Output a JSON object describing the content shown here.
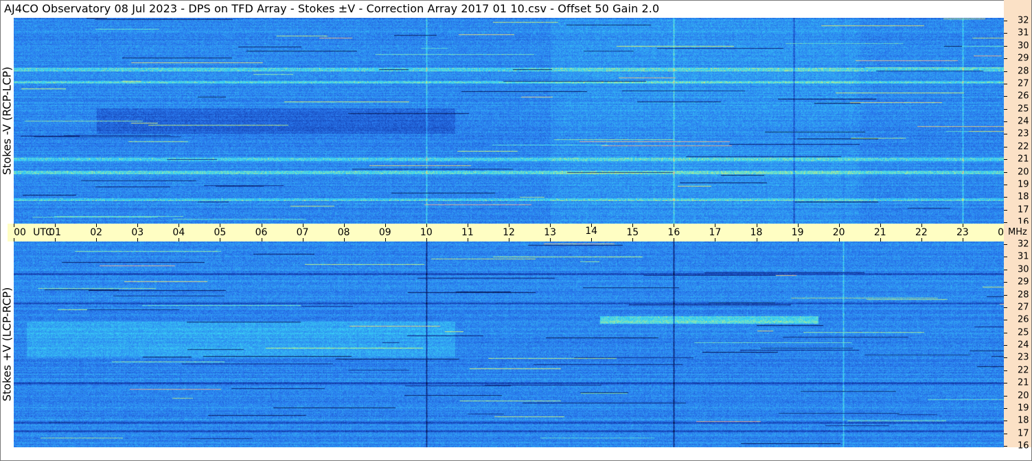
{
  "title": "AJ4CO Observatory  08 Jul 2023  -  DPS on TFD Array  -  Stokes ±V  -  Correction Array 2017 01 10.csv  -  Offset 50  Gain 2.0",
  "colors": {
    "background_blue": "#2a7bf0",
    "dark_blue": "#1646b8",
    "light_cyan": "#3ad6f5",
    "yellow_green": "#d8f070",
    "magenta": "#e060d0",
    "navy": "#061a55",
    "axis_yellow": "#fffec3",
    "axis_peach": "#fbe1c6"
  },
  "chart_data": [
    {
      "type": "heatmap",
      "name": "panel-top",
      "ylabel": "Stokes -V (RCP-LCP)",
      "x_unit": "UTC",
      "y_unit": "MHz",
      "xlim": [
        0,
        24
      ],
      "ylim": [
        16,
        32
      ],
      "x_ticks": [
        "00",
        "01",
        "02",
        "03",
        "04",
        "05",
        "06",
        "07",
        "08",
        "09",
        "10",
        "11",
        "12",
        "13",
        "14",
        "15",
        "16",
        "17",
        "18",
        "19",
        "20",
        "21",
        "22",
        "23",
        "00"
      ],
      "y_ticks": [
        "16",
        "17",
        "18",
        "19",
        "20",
        "21",
        "22",
        "23",
        "24",
        "25",
        "26",
        "27",
        "28",
        "29",
        "30",
        "31",
        "32"
      ],
      "features": {
        "bright_vertical_lines_hours": [
          10.0,
          16.0,
          20.1,
          23.0
        ],
        "dark_vertical_lines_hours": [
          18.9,
          20.1
        ],
        "dark_band_hours": [
          2.0,
          10.7
        ],
        "dark_band_mhz": [
          23.0,
          25.0
        ],
        "yellow_rows_mhz": [
          17.9,
          20.0,
          21.0,
          27.0,
          28.0
        ],
        "bright_region_hours": [
          13.0,
          20.5
        ]
      }
    },
    {
      "type": "heatmap",
      "name": "panel-bottom",
      "ylabel": "Stokes +V (LCP-RCP)",
      "x_unit": "UTC",
      "y_unit": "MHz",
      "xlim": [
        0,
        24
      ],
      "ylim": [
        16,
        32
      ],
      "x_ticks": [
        "00",
        "01",
        "02",
        "03",
        "04",
        "05",
        "06",
        "07",
        "08",
        "09",
        "10",
        "11",
        "12",
        "13",
        "14",
        "15",
        "16",
        "17",
        "18",
        "19",
        "20",
        "21",
        "22",
        "23",
        "00"
      ],
      "y_ticks": [
        "16",
        "17",
        "18",
        "19",
        "20",
        "21",
        "22",
        "23",
        "24",
        "25",
        "26",
        "27",
        "28",
        "29",
        "30",
        "31",
        "32"
      ],
      "features": {
        "dark_vertical_lines_hours": [
          10.0,
          16.0
        ],
        "bright_vertical_lines_hours": [
          20.1
        ],
        "bright_band_hours": [
          0.3,
          10.7
        ],
        "bright_band_mhz": [
          23.0,
          25.8
        ],
        "hot_band_hours": [
          14.2,
          19.5
        ],
        "hot_band_mhz": [
          25.6,
          26.2
        ],
        "dark_rows_mhz": [
          17.3,
          17.9,
          21.0,
          27.2,
          29.5
        ]
      }
    }
  ],
  "time_axis": {
    "labels": [
      "00",
      "01",
      "02",
      "03",
      "04",
      "05",
      "06",
      "07",
      "08",
      "09",
      "10",
      "11",
      "12",
      "13",
      "14",
      "15",
      "16",
      "17",
      "18",
      "19",
      "20",
      "21",
      "22",
      "23",
      "00"
    ],
    "utc_label": "UTC",
    "unit_label": "MHz"
  }
}
